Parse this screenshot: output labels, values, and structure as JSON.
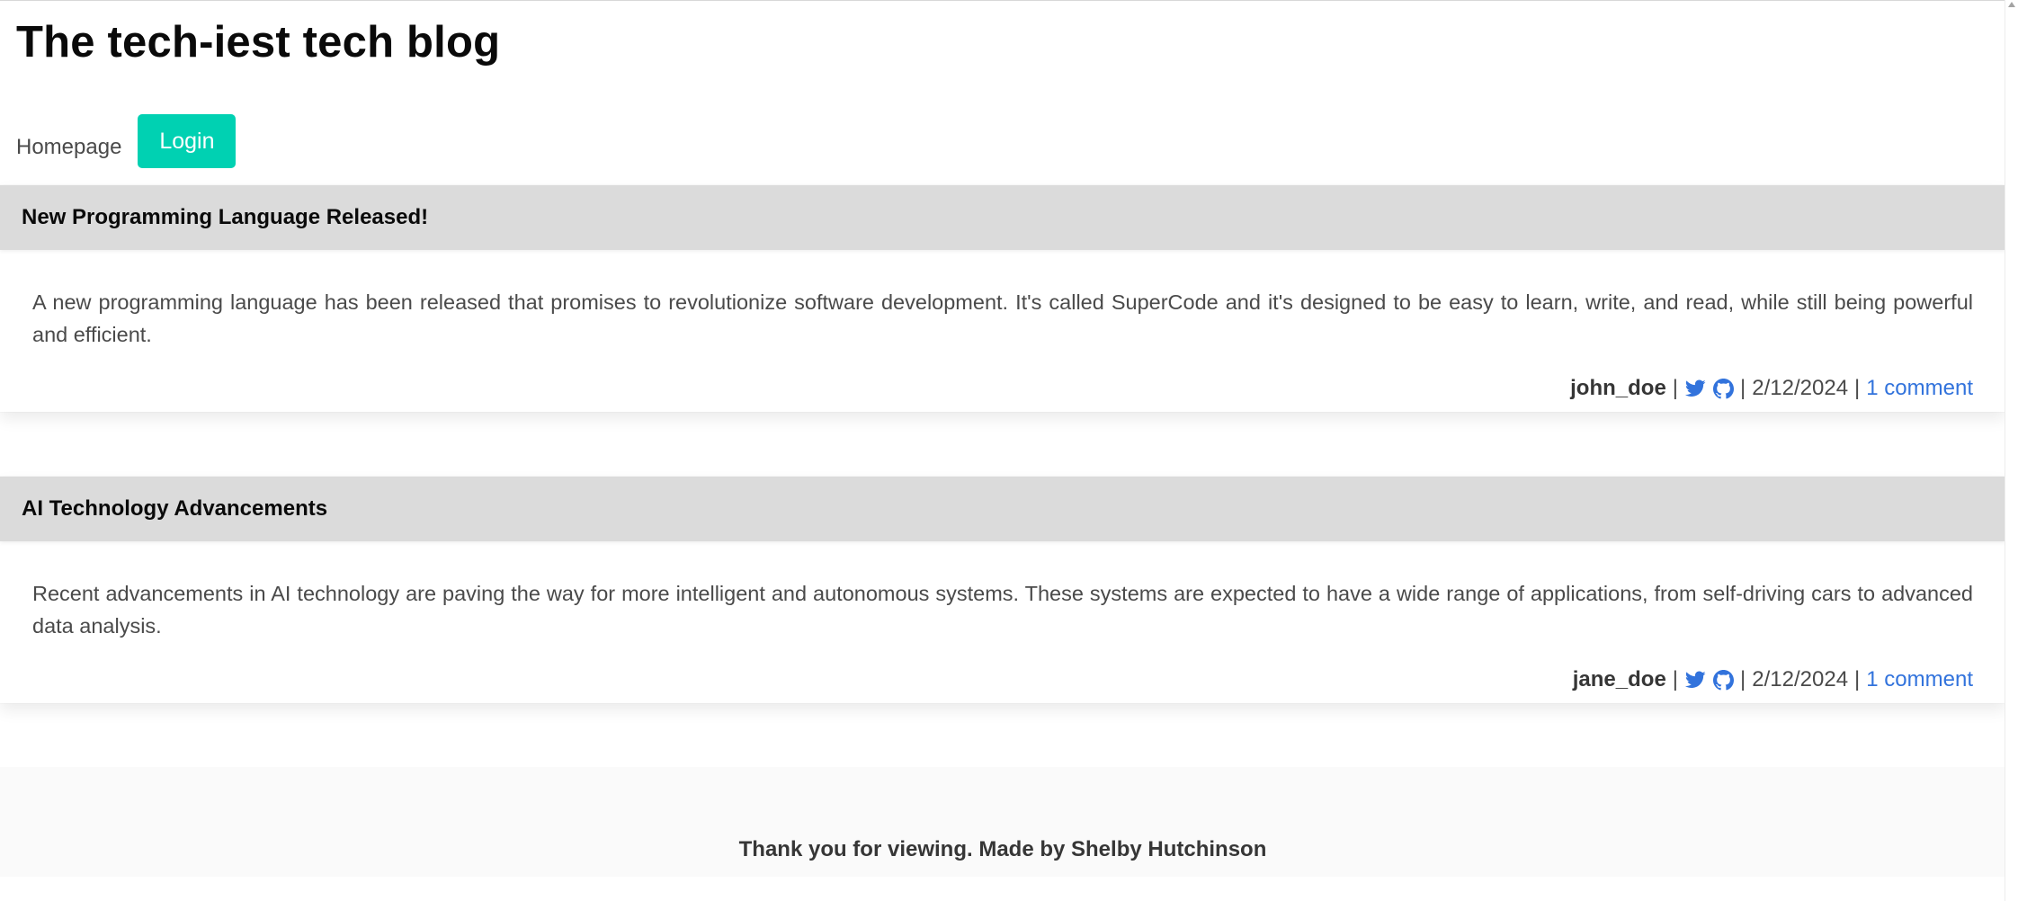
{
  "site": {
    "title": "The tech-iest tech blog"
  },
  "nav": {
    "homepage_label": "Homepage",
    "login_label": "Login"
  },
  "posts": [
    {
      "title": "New Programming Language Released!",
      "body": "A new programming language has been released that promises to revolutionize software development. It's called SuperCode and it's designed to be easy to learn, write, and read, while still being powerful and efficient.",
      "author": "john_doe",
      "separator": "|",
      "date": "2/12/2024",
      "comments": "1 comment"
    },
    {
      "title": "AI Technology Advancements",
      "body": "Recent advancements in AI technology are paving the way for more intelligent and autonomous systems. These systems are expected to have a wide range of applications, from self-driving cars to advanced data analysis.",
      "author": "jane_doe",
      "separator": "|",
      "date": "2/12/2024",
      "comments": "1 comment"
    }
  ],
  "icons": {
    "social_1": "twitter-icon",
    "social_2": "github-icon"
  },
  "colors": {
    "accent": "#00d1b2",
    "link": "#3273dc",
    "header_bg": "#dbdbdb",
    "footer_bg": "#fafafa"
  },
  "footer": {
    "text": "Thank you for viewing. Made by Shelby Hutchinson"
  }
}
